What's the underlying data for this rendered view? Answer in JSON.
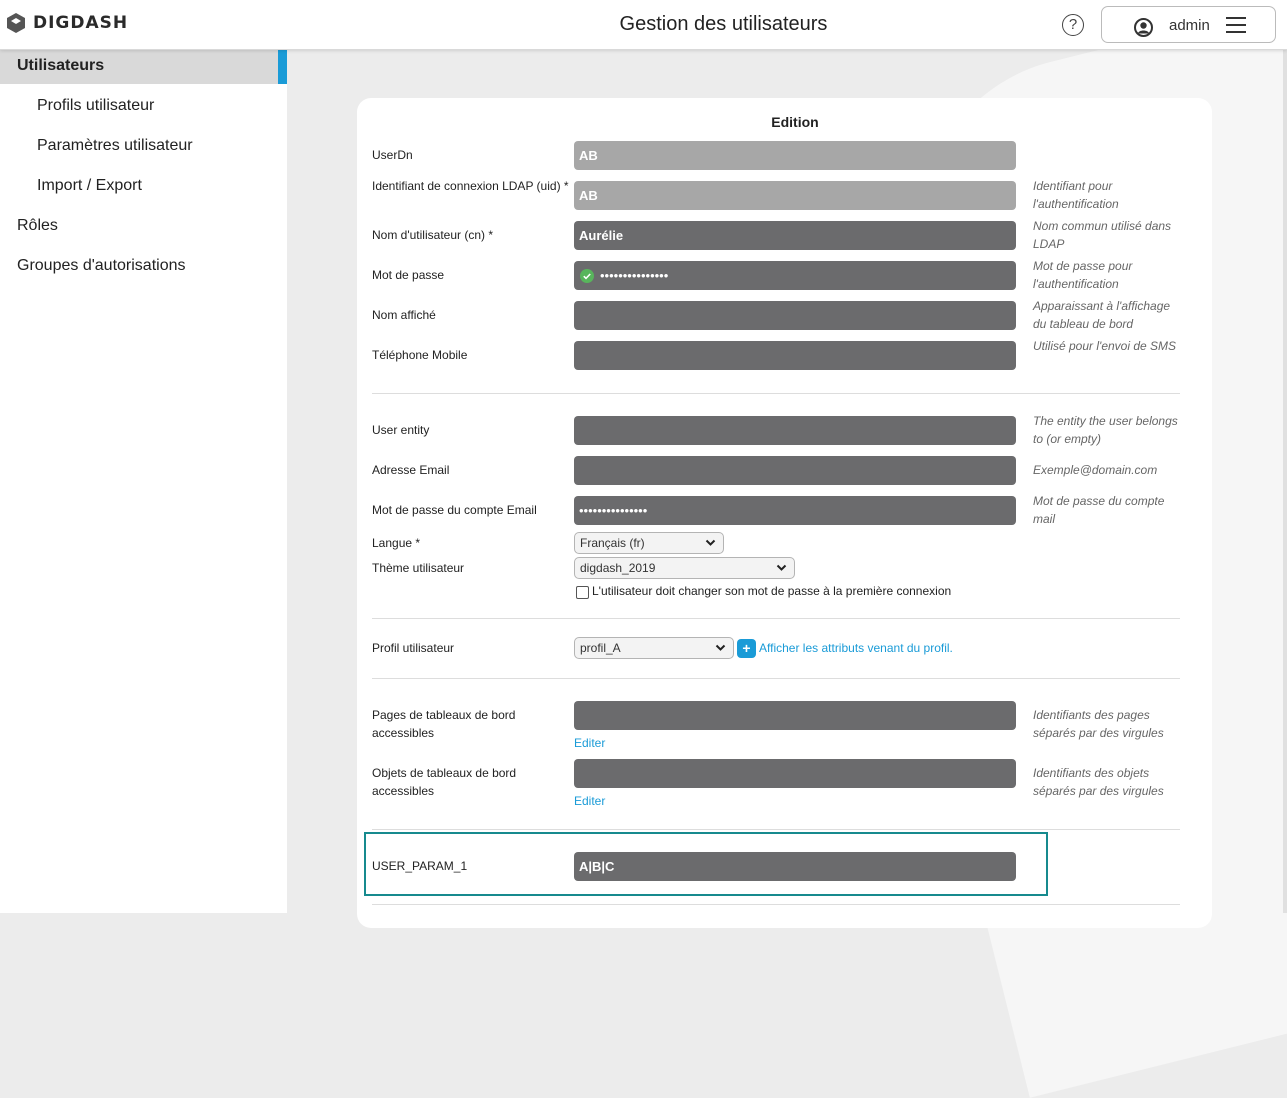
{
  "app": {
    "logo_text": "DIGDASH",
    "page_title": "Gestion des utilisateurs",
    "help_glyph": "?",
    "user_name": "admin"
  },
  "sidebar": {
    "items": [
      {
        "label": "Utilisateurs",
        "active": true
      },
      {
        "label": "Profils utilisateur"
      },
      {
        "label": "Paramètres utilisateur"
      },
      {
        "label": "Import / Export"
      },
      {
        "label": "Rôles"
      },
      {
        "label": "Groupes d'autorisations"
      }
    ]
  },
  "form": {
    "title": "Edition",
    "userdn": {
      "label": "UserDn",
      "value": "AB"
    },
    "uid": {
      "label": "Identifiant de connexion LDAP (uid) *",
      "value": "AB",
      "hint": "Identifiant pour l'authentification"
    },
    "cn": {
      "label": "Nom d'utilisateur (cn) *",
      "value": "Aurélie",
      "hint": "Nom commun utilisé dans LDAP"
    },
    "password": {
      "label": "Mot de passe",
      "value": "•••••••••••••••",
      "hint": "Mot de passe pour l'authentification"
    },
    "display_name": {
      "label": "Nom affiché",
      "value": "",
      "hint": "Apparaissant à l'affichage du tableau de bord"
    },
    "mobile": {
      "label": "Téléphone Mobile",
      "value": "",
      "hint": "Utilisé pour l'envoi de SMS"
    },
    "entity": {
      "label": "User entity",
      "value": "",
      "hint": "The entity the user belongs to (or empty)"
    },
    "email": {
      "label": "Adresse Email",
      "value": "",
      "hint": "Exemple@domain.com"
    },
    "email_password": {
      "label": "Mot de passe du compte Email",
      "value": "•••••••••••••••",
      "hint": "Mot de passe du compte mail"
    },
    "language": {
      "label": "Langue *",
      "value": "Français (fr)"
    },
    "theme": {
      "label": "Thème utilisateur",
      "value": "digdash_2019"
    },
    "force_change": {
      "label": "L'utilisateur doit changer son mot de passe à la première connexion",
      "checked": false
    },
    "profile": {
      "label": "Profil utilisateur",
      "value": "profil_A",
      "add_glyph": "+",
      "link": "Afficher les attributs venant du profil."
    },
    "pages": {
      "label": "Pages de tableaux de bord accessibles",
      "value": "",
      "edit": "Editer",
      "hint": "Identifiants des pages séparés par des virgules"
    },
    "objects": {
      "label": "Objets de tableaux de bord accessibles",
      "value": "",
      "edit": "Editer",
      "hint": "Identifiants des objets séparés par des virgules"
    },
    "user_param_1": {
      "label": "USER_PARAM_1",
      "value": "A|B|C"
    }
  },
  "colors": {
    "accent": "#1a9bd7",
    "input_dark": "#6b6b6d",
    "input_light": "#a7a7a7",
    "highlight_border": "#168a8e"
  }
}
